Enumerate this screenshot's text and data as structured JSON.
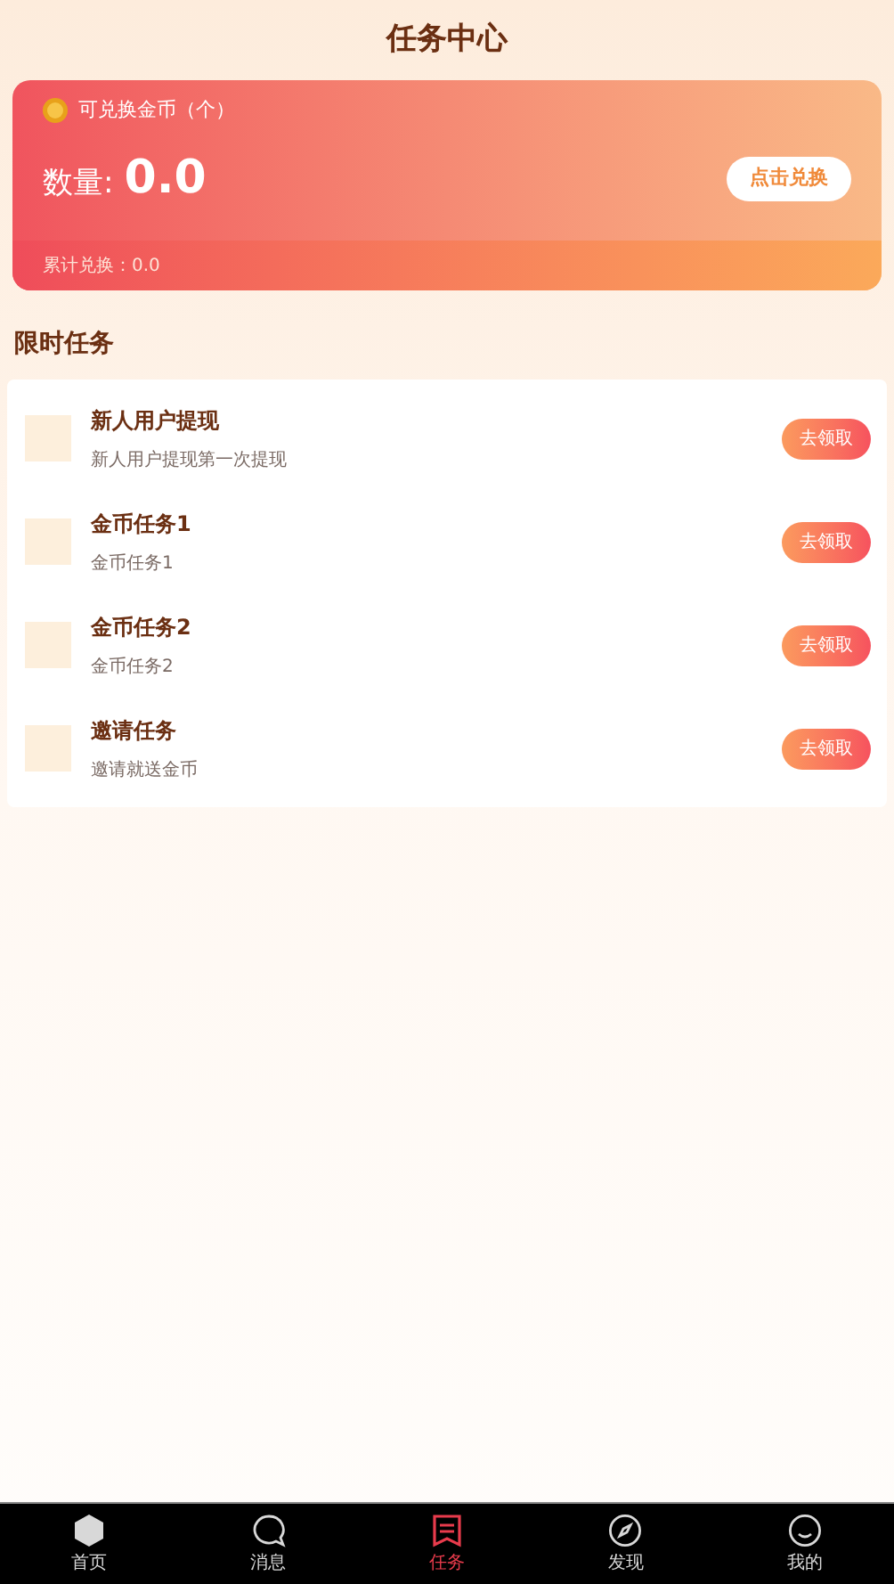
{
  "header": {
    "title": "任务中心"
  },
  "coin_card": {
    "label": "可兑换金币（个）",
    "amount_label": "数量:",
    "amount": "0.0",
    "button": "点击兑换",
    "total": "累计兑换：0.0"
  },
  "section_title": "限时任务",
  "tasks": [
    {
      "title": "新人用户提现",
      "subtitle": "新人用户提现第一次提现",
      "button": "去领取"
    },
    {
      "title": "金币任务1",
      "subtitle": "金币任务1",
      "button": "去领取"
    },
    {
      "title": "金币任务2",
      "subtitle": "金币任务2",
      "button": "去领取"
    },
    {
      "title": "邀请任务",
      "subtitle": "邀请就送金币",
      "button": "去领取"
    }
  ],
  "tab_bar": [
    {
      "kind": "home",
      "label": "首页",
      "selected": false
    },
    {
      "kind": "message",
      "label": "消息",
      "selected": false
    },
    {
      "kind": "task",
      "label": "任务",
      "selected": true
    },
    {
      "kind": "discover",
      "label": "发现",
      "selected": false
    },
    {
      "kind": "profile",
      "label": "我的",
      "selected": false
    }
  ]
}
